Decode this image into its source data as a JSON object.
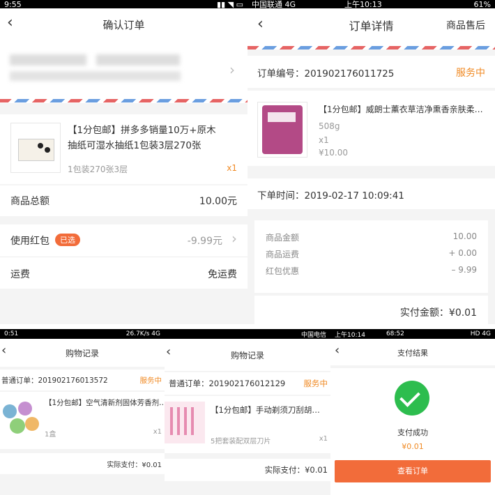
{
  "p1": {
    "status_time": "9:55",
    "title": "确认订单",
    "product_title_line1": "【1分包邮】拼多多销量10万+原木",
    "product_title_line2": "抽纸可湿水抽纸1包装3层270张",
    "spec": "1包装270张3层",
    "qty": "x1",
    "total_label": "商品总额",
    "total_value": "10.00元",
    "redpack_label": "使用红包",
    "redpack_tag": "已选",
    "redpack_value": "-9.99元",
    "shipping_label": "运费",
    "shipping_value": "免运费"
  },
  "p2": {
    "status_carrier": "中国联通  4G",
    "status_time": "上午10:13",
    "status_battery": "61%",
    "title": "订单详情",
    "after_sale": "商品售后",
    "order_no_label": "订单编号：",
    "order_no": "201902176011725",
    "status": "服务中",
    "product_title": "【1分包邮】威朗士薰衣草洁净熏香亲肤柔…",
    "weight": "508g",
    "qty": "x1",
    "price": "¥10.00",
    "time_label": "下单时间：",
    "time_value": "2019-02-17 10:09:41",
    "fees": [
      {
        "label": "商品金额",
        "value": "10.00"
      },
      {
        "label": "商品运费",
        "value": "+ 0.00"
      },
      {
        "label": "红包优惠",
        "value": "– 9.99"
      }
    ],
    "paid_label": "实付金额：",
    "paid_value": "¥0.01"
  },
  "p3": {
    "status_left": "0:51",
    "status_right": "26.7K/s 4G",
    "title": "购物记录",
    "order_label": "普通订单：",
    "order_no": "201902176013572",
    "status": "服务中",
    "product_title": "【1分包邮】空气清新剂固体芳香剂…",
    "spec": "1盒",
    "qty": "x1",
    "paid_label": "实际支付：",
    "paid_value": "¥0.01"
  },
  "p4": {
    "status_left": "中国电信",
    "title": "购物记录",
    "order_label": "普通订单：",
    "order_no": "201902176012129",
    "status": "服务中",
    "product_title": "【1分包邮】手动剃须刀刮胡…",
    "spec": "5把套装配双层刀片",
    "qty": "x1",
    "paid_label": "实际支付：",
    "paid_value": "¥0.01"
  },
  "p5": {
    "status_left": "上午10:14",
    "status_right": "68:52",
    "status_far": "HD 4G",
    "title": "支付结果",
    "success": "支付成功",
    "amount": "¥0.01",
    "button": "查看订单"
  },
  "colors": {
    "accent": "#f26c3a",
    "status_orange": "#f08a24",
    "success_green": "#2dbd4e"
  }
}
